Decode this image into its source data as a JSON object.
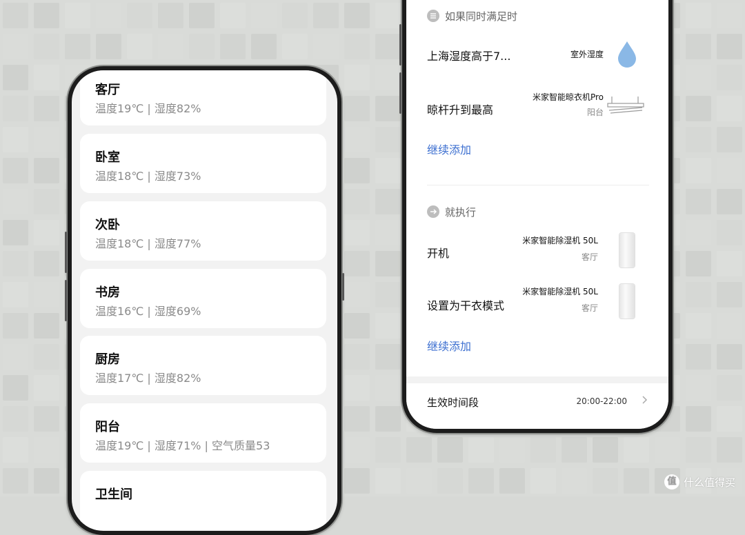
{
  "left_phone": {
    "rooms": [
      {
        "name": "客厅",
        "info": "温度19℃ | 湿度82%"
      },
      {
        "name": "卧室",
        "info": "温度18℃ | 湿度73%"
      },
      {
        "name": "次卧",
        "info": "温度18℃ | 湿度77%"
      },
      {
        "name": "书房",
        "info": "温度16℃ | 湿度69%"
      },
      {
        "name": "厨房",
        "info": "温度17℃ | 湿度82%"
      },
      {
        "name": "阳台",
        "info": "温度19℃ | 湿度71% | 空气质量53"
      },
      {
        "name": "卫生间",
        "info": ""
      }
    ]
  },
  "right_phone": {
    "condition_section": {
      "title": "如果同时满足时",
      "icon": "list-icon",
      "rows": [
        {
          "title": "上海湿度高于7...",
          "device": "室外湿度",
          "room": "",
          "icon": "water-drop-icon"
        },
        {
          "title": "晾杆升到最高",
          "device": "米家智能晾衣机Pro",
          "room": "阳台",
          "icon": "clothes-rack-icon"
        }
      ],
      "add_label": "继续添加"
    },
    "action_section": {
      "title": "就执行",
      "icon": "arrow-right-icon",
      "rows": [
        {
          "title": "开机",
          "device": "米家智能除湿机 50L",
          "room": "客厅",
          "icon": "dehumidifier-icon"
        },
        {
          "title": "设置为干衣模式",
          "device": "米家智能除湿机 50L",
          "room": "客厅",
          "icon": "dehumidifier-icon"
        }
      ],
      "add_label": "继续添加"
    },
    "effective_time": {
      "label": "生效时间段",
      "value": "20:00-22:00"
    }
  },
  "watermark": {
    "text": "什么值得买",
    "logo": "值"
  },
  "colors": {
    "accent_link": "#3c6fd0",
    "drop": "#8ab8e6",
    "background": "#d9dbd8"
  }
}
